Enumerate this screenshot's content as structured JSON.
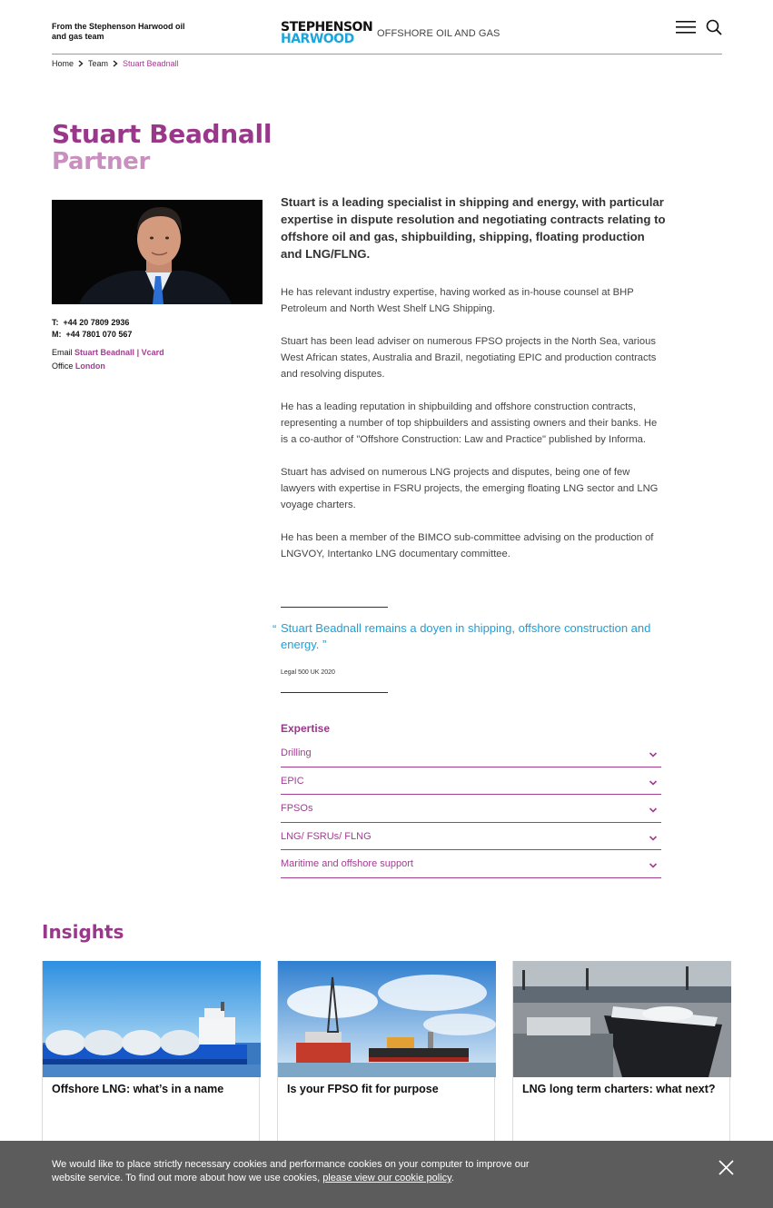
{
  "header": {
    "tagline": "From the Stephenson Harwood oil and gas team",
    "logo_line1": "STEPHENSON",
    "logo_line2": "HARWOOD",
    "subbrand": "OFFSHORE OIL AND GAS",
    "menu_icon": "hamburger-menu-icon",
    "search_icon": "search-icon"
  },
  "breadcrumb": {
    "home": "Home",
    "team": "Team",
    "current": "Stuart Beadnall"
  },
  "profile": {
    "name": "Stuart Beadnall",
    "role": "Partner",
    "phone_label": "T:",
    "phone": "+44 20 7809 2936",
    "mobile_label": "M:",
    "mobile": "+44 7801 070 567",
    "email_label": "Email",
    "email_link": "Stuart Beadnall",
    "separator": "|",
    "vcard_link": "Vcard",
    "office_label": "Office",
    "office_link": "London"
  },
  "bio": {
    "lead": "Stuart is a leading specialist in shipping and energy, with particular expertise in dispute resolution and negotiating contracts relating to offshore oil and gas, shipbuilding, shipping, floating production and LNG/FLNG.",
    "paragraphs": [
      "He has relevant industry expertise, having worked as in-house counsel at BHP Petroleum and North West Shelf LNG Shipping.",
      "Stuart has been lead adviser on numerous FPSO projects in the North Sea, various West African states, Australia and Brazil, negotiating EPIC and production contracts and resolving disputes.",
      "He has a leading reputation in shipbuilding and offshore construction contracts, representing a number of top shipbuilders and assisting owners and their banks. He is a co-author of \"Offshore Construction: Law and Practice\" published by Informa.",
      "Stuart has advised on numerous LNG projects and disputes, being one of few lawyers with expertise in FSRU projects, the emerging floating LNG sector and LNG voyage charters.",
      "He has been a member of the BIMCO sub-committee advising on the production of LNGVOY, Intertanko LNG documentary committee."
    ]
  },
  "quote": {
    "open_mark": "“",
    "text": "Stuart Beadnall remains a doyen in shipping, offshore construction and energy. ”",
    "source": "Legal 500 UK 2020"
  },
  "expertise": {
    "title": "Expertise",
    "items": [
      "Drilling",
      "EPIC",
      "FPSOs",
      "LNG/ FSRUs/ FLNG",
      "Maritime and offshore support"
    ]
  },
  "insights": {
    "title": "Insights",
    "cards": [
      {
        "title": "Offshore LNG: what’s in a name"
      },
      {
        "title": "Is your FPSO fit for purpose"
      },
      {
        "title": "LNG long term charters: what next?"
      }
    ]
  },
  "cookie": {
    "text": "We would like to place strictly necessary cookies and performance cookies on your computer to improve our website service. To find out more about how we use cookies, ",
    "link": "please view our cookie policy",
    "end": ".",
    "close_icon": "close-icon"
  },
  "colors": {
    "brand_purple": "#99378a",
    "light_purple": "#c88fbf",
    "link_purple": "#a23d92",
    "quote_blue": "#1e9fd6",
    "logo_blue": "#1ca5dc",
    "cookie_bg": "#5c5c5c"
  }
}
